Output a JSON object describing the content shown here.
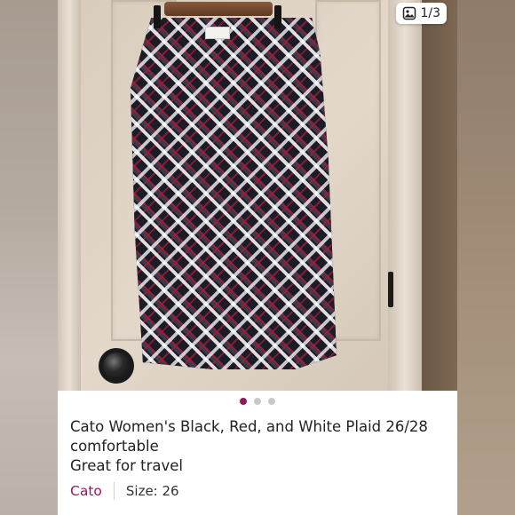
{
  "carousel": {
    "counter": "1/3",
    "image_icon": "image-icon",
    "dots": 3,
    "active_dot": 0
  },
  "listing": {
    "title_line1": "Cato Women's Black, Red, and White Plaid 26/28",
    "title_line2": "comfortable",
    "title_line3": "Great for travel",
    "brand": "Cato",
    "size": "Size: 26"
  },
  "colors": {
    "brand_accent": "#8a1c5c",
    "inactive_dot": "#c9c9c9"
  }
}
